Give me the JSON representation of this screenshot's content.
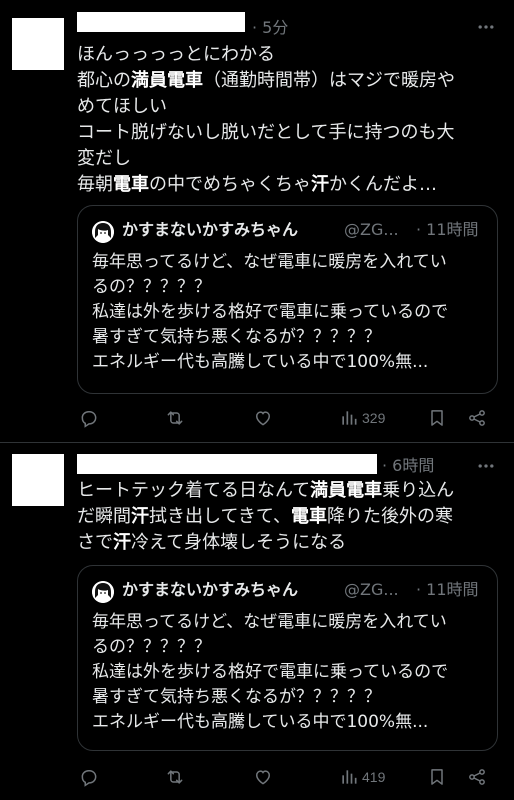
{
  "colors": {
    "background": "#000000",
    "text": "#e7e9ea",
    "muted": "#71767b",
    "border": "#2f3336"
  },
  "posts": [
    {
      "time": "· 5分",
      "lines": [
        [
          {
            "t": "ほんっっっっとにわかる"
          }
        ],
        [
          {
            "t": "都心の"
          },
          {
            "t": "満員電車",
            "b": true
          },
          {
            "t": "（通勤時間帯）はマジで暖房や"
          }
        ],
        [
          {
            "t": "めてほしい"
          }
        ],
        [
          {
            "t": "コート脱げないし脱いだとして手に持つのも大"
          }
        ],
        [
          {
            "t": "変だし"
          }
        ],
        [
          {
            "t": "毎朝"
          },
          {
            "t": "電車",
            "b": true
          },
          {
            "t": "の中でめちゃくちゃ"
          },
          {
            "t": "汗",
            "b": true
          },
          {
            "t": "かくんだよ…"
          }
        ]
      ],
      "quote": {
        "name": "かすまないかすみちゃん",
        "handle": "@ZG...",
        "time": "· 11時間",
        "lines": [
          "毎年思ってるけど、なぜ電車に暖房を入れてい",
          "るの？？？？？",
          "私達は外を歩ける格好で電車に乗っているので",
          "暑すぎて気持ち悪くなるが？？？？？",
          "エネルギー代も高騰している中で100%無..."
        ]
      },
      "views": "329",
      "icons": [
        "reply-icon",
        "repost-icon",
        "like-icon",
        "views-icon",
        "bookmark-icon",
        "share-icon"
      ]
    },
    {
      "time": "· 6時間",
      "lines": [
        [
          {
            "t": "ヒートテック着てる日なんて"
          },
          {
            "t": "満員電車",
            "b": true
          },
          {
            "t": "乗り込ん"
          }
        ],
        [
          {
            "t": "だ瞬間"
          },
          {
            "t": "汗",
            "b": true
          },
          {
            "t": "拭き出してきて、"
          },
          {
            "t": "電車",
            "b": true
          },
          {
            "t": "降りた後外の寒"
          }
        ],
        [
          {
            "t": "さで"
          },
          {
            "t": "汗",
            "b": true
          },
          {
            "t": "冷えて身体壊しそうになる"
          }
        ]
      ],
      "quote": {
        "name": "かすまないかすみちゃん",
        "handle": "@ZG...",
        "time": "· 11時間",
        "lines": [
          "毎年思ってるけど、なぜ電車に暖房を入れてい",
          "るの？？？？？",
          "私達は外を歩ける格好で電車に乗っているので",
          "暑すぎて気持ち悪くなるが？？？？？",
          "エネルギー代も高騰している中で100%無..."
        ]
      },
      "views": "419",
      "icons": [
        "reply-icon",
        "repost-icon",
        "like-icon",
        "views-icon",
        "bookmark-icon",
        "share-icon"
      ]
    }
  ]
}
